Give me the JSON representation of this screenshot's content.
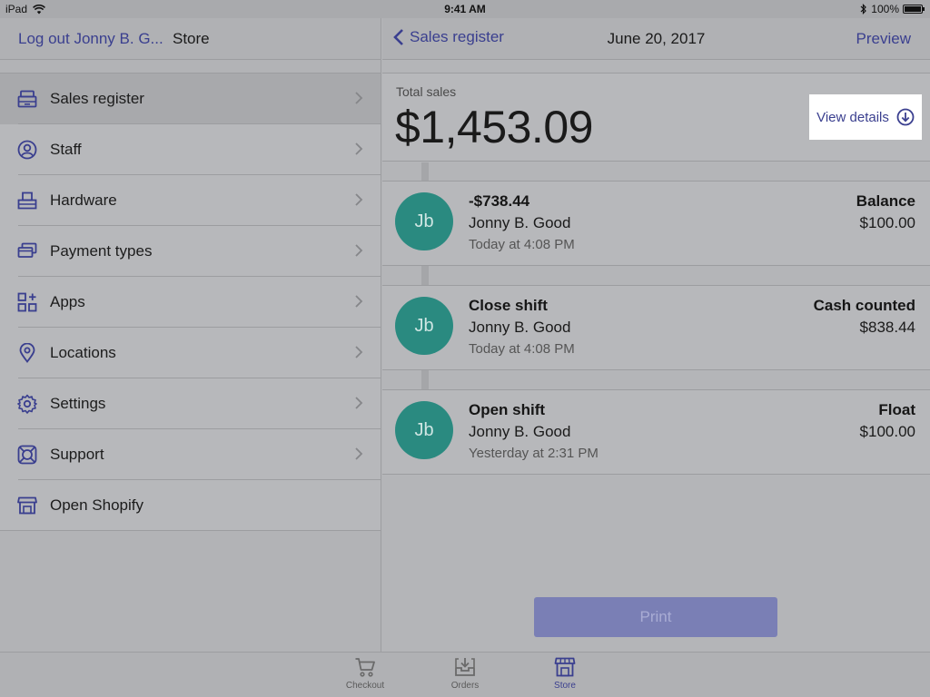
{
  "status_bar": {
    "device": "iPad",
    "time": "9:41 AM",
    "battery": "100%"
  },
  "left_nav": {
    "logout": "Log out Jonny B. G...",
    "title": "Store"
  },
  "menu": [
    {
      "label": "Sales register",
      "icon": "register-icon"
    },
    {
      "label": "Staff",
      "icon": "user-circle-icon"
    },
    {
      "label": "Hardware",
      "icon": "printer-icon"
    },
    {
      "label": "Payment types",
      "icon": "cards-icon"
    },
    {
      "label": "Apps",
      "icon": "apps-grid-icon"
    },
    {
      "label": "Locations",
      "icon": "location-pin-icon"
    },
    {
      "label": "Settings",
      "icon": "gear-icon"
    },
    {
      "label": "Support",
      "icon": "lifebuoy-icon"
    },
    {
      "label": "Open Shopify",
      "icon": "storefront-icon"
    }
  ],
  "right_nav": {
    "back_label": "Sales register",
    "date": "June 20, 2017",
    "preview": "Preview"
  },
  "totals": {
    "label": "Total sales",
    "amount": "$1,453.09",
    "view_details": "View details"
  },
  "entries": [
    {
      "initials": "Jb",
      "title": "-$738.44",
      "name": "Jonny B. Good",
      "time": "Today at 4:08 PM",
      "right_label": "Balance",
      "right_value": "$100.00"
    },
    {
      "initials": "Jb",
      "title": "Close shift",
      "name": "Jonny B. Good",
      "time": "Today at 4:08 PM",
      "right_label": "Cash counted",
      "right_value": "$838.44"
    },
    {
      "initials": "Jb",
      "title": "Open shift",
      "name": "Jonny B. Good",
      "time": "Yesterday at 2:31 PM",
      "right_label": "Float",
      "right_value": "$100.00"
    }
  ],
  "print_label": "Print",
  "tabs": [
    {
      "label": "Checkout",
      "icon": "cart-icon"
    },
    {
      "label": "Orders",
      "icon": "orders-tray-icon"
    },
    {
      "label": "Store",
      "icon": "storefront-icon"
    }
  ],
  "colors": {
    "accent": "#3a3f8f",
    "avatar": "#2a8a80",
    "print_button": "#7a7fb5"
  }
}
